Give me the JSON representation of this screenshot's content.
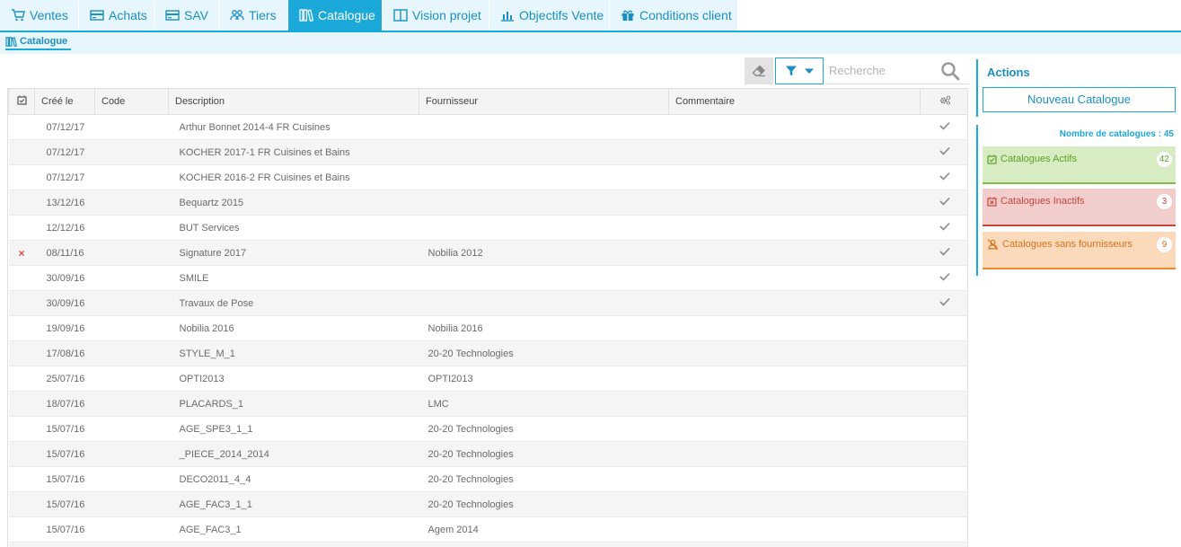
{
  "nav": {
    "tabs": [
      {
        "label": "Ventes",
        "icon": "cart-icon"
      },
      {
        "label": "Achats",
        "icon": "card-icon"
      },
      {
        "label": "SAV",
        "icon": "card-icon"
      },
      {
        "label": "Tiers",
        "icon": "users-icon"
      },
      {
        "label": "Catalogue",
        "icon": "books-icon",
        "active": true
      },
      {
        "label": "Vision projet",
        "icon": "columns-icon"
      },
      {
        "label": "Objectifs Vente",
        "icon": "bar-chart-icon"
      },
      {
        "label": "Conditions client",
        "icon": "gift-icon"
      }
    ]
  },
  "subnav": {
    "label": "Catalogue"
  },
  "toolbar": {
    "search_placeholder": "Recherche"
  },
  "table": {
    "columns": [
      "",
      "Créé le",
      "Code",
      "Description",
      "Fournisseur",
      "Commentaire",
      ""
    ],
    "rows": [
      {
        "mark": "",
        "date": "07/12/17",
        "code": "",
        "description": "Arthur Bonnet 2014-4 FR Cuisines",
        "fournisseur": "",
        "commentaire": "",
        "checked": true
      },
      {
        "mark": "",
        "date": "07/12/17",
        "code": "",
        "description": "KOCHER 2017-1 FR Cuisines et Bains",
        "fournisseur": "",
        "commentaire": "",
        "checked": true
      },
      {
        "mark": "",
        "date": "07/12/17",
        "code": "",
        "description": "KOCHER 2016-2 FR Cuisines et Bains",
        "fournisseur": "",
        "commentaire": "",
        "checked": true
      },
      {
        "mark": "",
        "date": "13/12/16",
        "code": "",
        "description": "Bequartz 2015",
        "fournisseur": "",
        "commentaire": "",
        "checked": true
      },
      {
        "mark": "",
        "date": "12/12/16",
        "code": "",
        "description": "BUT Services",
        "fournisseur": "",
        "commentaire": "",
        "checked": true
      },
      {
        "mark": "×",
        "date": "08/11/16",
        "code": "",
        "description": "Signature 2017",
        "fournisseur": "Nobilia 2012",
        "commentaire": "",
        "checked": true
      },
      {
        "mark": "",
        "date": "30/09/16",
        "code": "",
        "description": "SMILE",
        "fournisseur": "",
        "commentaire": "",
        "checked": true
      },
      {
        "mark": "",
        "date": "30/09/16",
        "code": "",
        "description": "Travaux de Pose",
        "fournisseur": "",
        "commentaire": "",
        "checked": true
      },
      {
        "mark": "",
        "date": "19/09/16",
        "code": "",
        "description": "Nobilia 2016",
        "fournisseur": "Nobilia 2016",
        "commentaire": "",
        "checked": false
      },
      {
        "mark": "",
        "date": "17/08/16",
        "code": "",
        "description": "STYLE_M_1",
        "fournisseur": "20-20 Technologies",
        "commentaire": "",
        "checked": false
      },
      {
        "mark": "",
        "date": "25/07/16",
        "code": "",
        "description": "OPTI2013",
        "fournisseur": "OPTI2013",
        "commentaire": "",
        "checked": false
      },
      {
        "mark": "",
        "date": "18/07/16",
        "code": "",
        "description": "PLACARDS_1",
        "fournisseur": "LMC",
        "commentaire": "",
        "checked": false
      },
      {
        "mark": "",
        "date": "15/07/16",
        "code": "",
        "description": "AGE_SPE3_1_1",
        "fournisseur": "20-20 Technologies",
        "commentaire": "",
        "checked": false
      },
      {
        "mark": "",
        "date": "15/07/16",
        "code": "",
        "description": "_PIECE_2014_2014",
        "fournisseur": "20-20 Technologies",
        "commentaire": "",
        "checked": false
      },
      {
        "mark": "",
        "date": "15/07/16",
        "code": "",
        "description": "DECO2011_4_4",
        "fournisseur": "20-20 Technologies",
        "commentaire": "",
        "checked": false
      },
      {
        "mark": "",
        "date": "15/07/16",
        "code": "",
        "description": "AGE_FAC3_1_1",
        "fournisseur": "20-20 Technologies",
        "commentaire": "",
        "checked": false
      },
      {
        "mark": "",
        "date": "15/07/16",
        "code": "",
        "description": "AGE_FAC3_1",
        "fournisseur": "Agem 2014",
        "commentaire": "",
        "checked": false
      },
      {
        "mark": "",
        "date": "",
        "code": "",
        "description": "",
        "fournisseur": "",
        "commentaire": "",
        "checked": false
      }
    ]
  },
  "actions": {
    "title": "Actions",
    "new_catalog_label": "Nouveau Catalogue"
  },
  "stats": {
    "count_label": "Nombre de catalogues : 45",
    "cards": [
      {
        "label": "Catalogues Actifs",
        "count": "42",
        "color": "#5aa224"
      },
      {
        "label": "Catalogues Inactifs",
        "count": "3",
        "color": "#c7453a"
      },
      {
        "label": "Catalogues sans fournisseurs",
        "count": "9",
        "color": "#d77218"
      }
    ]
  },
  "colors": {
    "accent": "#1ba9d9",
    "tab_bg": "#e6f6fc",
    "tab_text": "#1a8fc2"
  }
}
